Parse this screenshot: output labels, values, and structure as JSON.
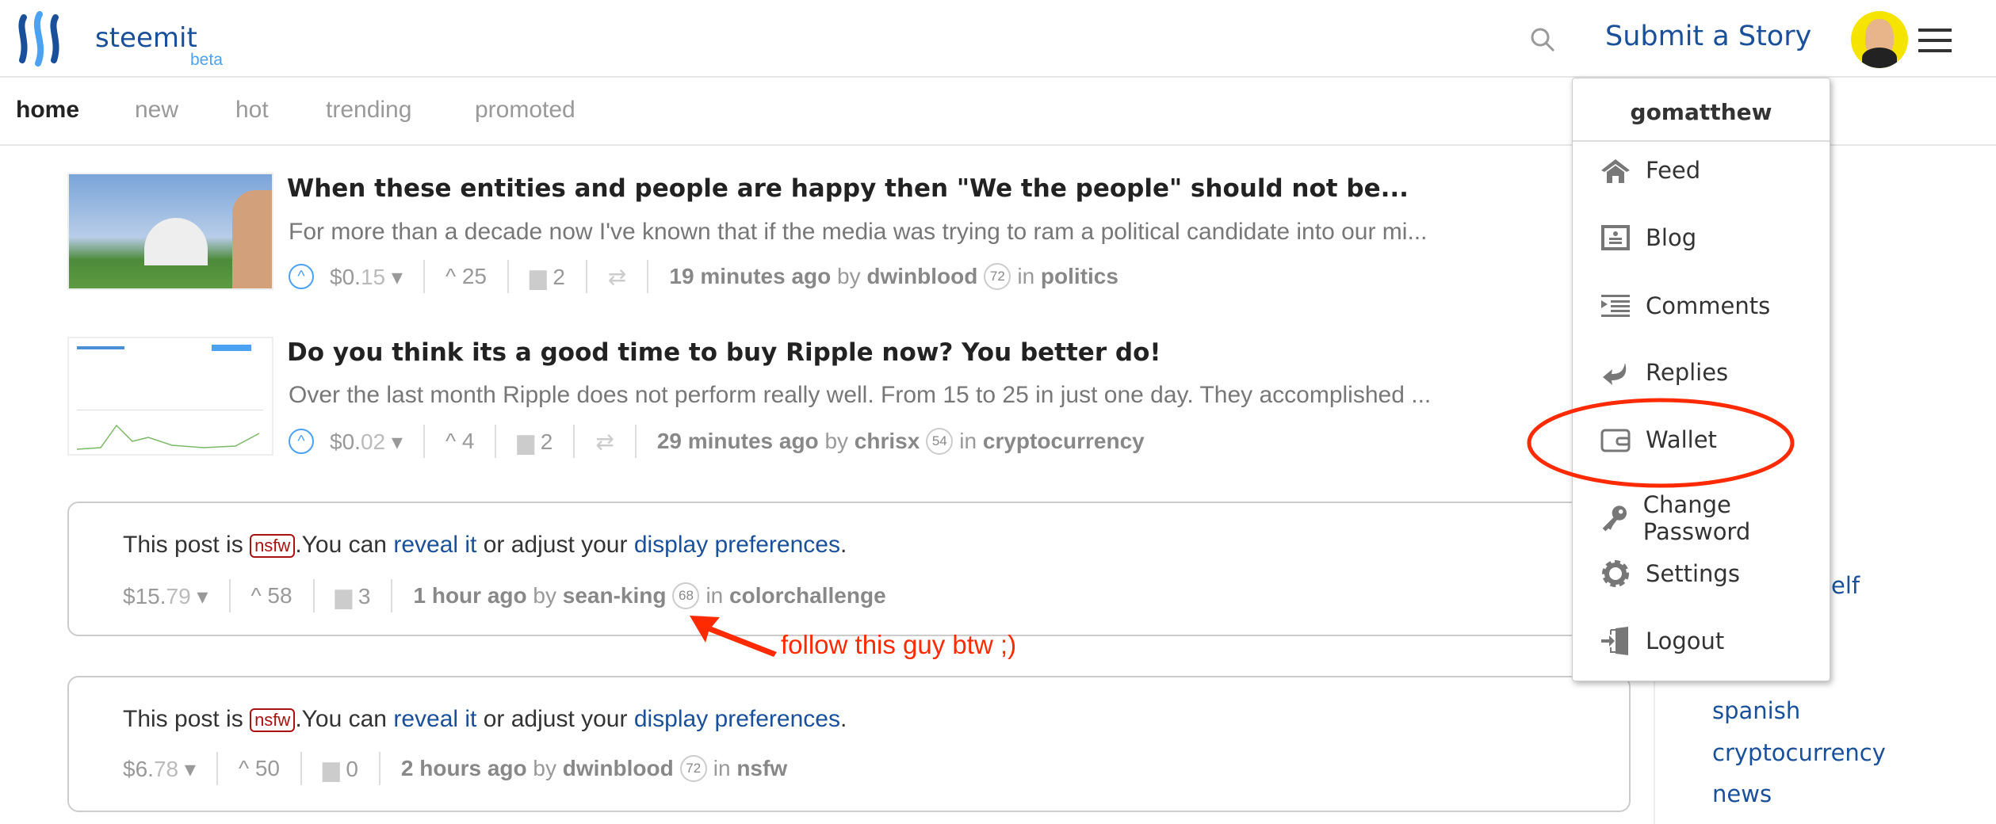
{
  "header": {
    "brand": "steemit",
    "sub": "beta",
    "submit_label": "Submit a Story",
    "icons": {
      "search": "search-icon",
      "menu": "hamburger-icon"
    }
  },
  "nav": {
    "tabs": [
      {
        "label": "home",
        "active": true
      },
      {
        "label": "new"
      },
      {
        "label": "hot"
      },
      {
        "label": "trending"
      },
      {
        "label": "promoted"
      }
    ]
  },
  "posts": [
    {
      "title": "When these entities and people are happy then \"We the people\" should not be...",
      "excerpt": "For more than a decade now I've known that if the media was trying to ram a political candidate into our mi...",
      "payout_whole": "$0.",
      "payout_cents": "15",
      "votes": "25",
      "comments": "2",
      "time": "19 minutes ago",
      "by": "by",
      "author": "dwinblood",
      "rep": "72",
      "in": "in",
      "category": "politics"
    },
    {
      "title": "Do you think its a good time to buy Ripple now? You better do!",
      "excerpt": "Over the last month Ripple does not perform really well. From 15 to 25 in just one day. They accomplished ...",
      "payout_whole": "$0.",
      "payout_cents": "02",
      "votes": "4",
      "comments": "2",
      "time": "29 minutes ago",
      "by": "by",
      "author": "chrisx",
      "rep": "54",
      "in": "in",
      "category": "cryptocurrency"
    }
  ],
  "nsfw_posts": [
    {
      "prefix": "This post is",
      "tag": "nsfw",
      "mid": ".You can",
      "reveal": "reveal it",
      "or": "or adjust your",
      "prefs": "display preferences",
      "end": ".",
      "payout_whole": "$15.",
      "payout_cents": "79",
      "votes": "58",
      "comments": "3",
      "time": "1 hour ago",
      "by": "by",
      "author": "sean-king",
      "rep": "68",
      "in": "in",
      "category": "colorchallenge"
    },
    {
      "prefix": "This post is",
      "tag": "nsfw",
      "mid": ".You can",
      "reveal": "reveal it",
      "or": "or adjust your",
      "prefs": "display preferences",
      "end": ".",
      "payout_whole": "$6.",
      "payout_cents": "78",
      "votes": "50",
      "comments": "0",
      "time": "2 hours ago",
      "by": "by",
      "author": "dwinblood",
      "rep": "72",
      "in": "in",
      "category": "nsfw"
    }
  ],
  "annotation": {
    "text": "follow this guy btw ;)",
    "color": "#ff2a00"
  },
  "user_menu": {
    "username": "gomatthew",
    "items": [
      "Feed",
      "Blog",
      "Comments",
      "Replies",
      "Wallet",
      "Change Password",
      "Settings",
      "Logout"
    ]
  },
  "sidebar": {
    "partial": "elf",
    "tags": [
      "spanish",
      "cryptocurrency",
      "news"
    ]
  },
  "colors": {
    "link": "#1a5099",
    "accent": "#4ba2f2",
    "nsfw": "#aa1111"
  }
}
